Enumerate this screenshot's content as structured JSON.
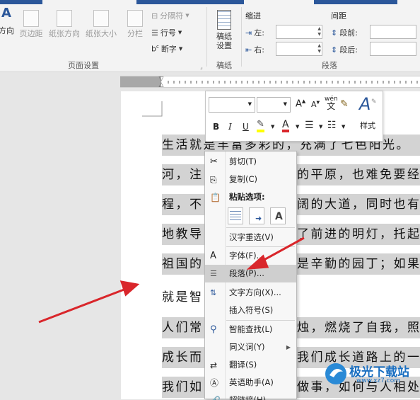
{
  "ribbon": {
    "page_setup": {
      "btn_direction": "方向",
      "btn_margin": "页边距",
      "btn_paper_dir": "纸张方向",
      "btn_paper_size": "纸张大小",
      "btn_columns": "分栏",
      "separator": "分隔符",
      "line_no": "行号",
      "hyphen": "断字",
      "group_label": "页面设置"
    },
    "draft": {
      "label_line1": "稿纸",
      "label_line2": "设置",
      "group_label": "稿纸"
    },
    "paragraph": {
      "indent_header": "缩进",
      "spacing_header": "间距",
      "left_label": "左:",
      "right_label": "右:",
      "before_label": "段前:",
      "after_label": "段后:",
      "group_label": "段落"
    }
  },
  "minibar": {
    "style_label": "样式",
    "wen_label": "wén"
  },
  "document": {
    "lines": [
      "生活就是丰富多彩的，充满了七色阳光。",
      "河，注",
      "程，不",
      "地教导",
      "祖国的",
      "就是智",
      "人们常",
      "成长而",
      "我们如"
    ],
    "lines_right": [
      "",
      "的平原，也难免要经",
      "阔的大道，同时也有",
      "了前进的明灯，托起",
      "是辛勤的园丁；如果",
      "",
      "烛，燃烧了自我，照",
      "我们成长道路上的一",
      "做事，如何与人相处"
    ]
  },
  "context_menu": {
    "items": [
      {
        "label": "剪切(T)",
        "icon": "scissors-icon"
      },
      {
        "label": "复制(C)",
        "icon": "copy-icon"
      },
      {
        "label": "粘贴选项:",
        "icon": "paste-icon"
      },
      {
        "label": "汉字重选(V)",
        "icon": ""
      },
      {
        "label": "字体(F)...",
        "icon": "font-icon"
      },
      {
        "label": "段落(P)...",
        "icon": "paragraph-icon"
      },
      {
        "label": "文字方向(X)...",
        "icon": "text-direction-icon"
      },
      {
        "label": "插入符号(S)",
        "icon": ""
      },
      {
        "label": "智能查找(L)",
        "icon": "search-icon"
      },
      {
        "label": "同义词(Y)",
        "icon": ""
      },
      {
        "label": "翻译(S)",
        "icon": "translate-icon"
      },
      {
        "label": "英语助手(A)",
        "icon": "english-assistant-icon"
      },
      {
        "label": "超链接(H)...",
        "icon": "link-icon"
      }
    ]
  },
  "watermark": {
    "text": "极光下载站",
    "url": "www.xz7.com"
  },
  "colors": {
    "accent": "#2b579a",
    "highlight": "#d3d3d3",
    "selected_item": "#cfcfcf",
    "arrow": "#d9262b"
  }
}
